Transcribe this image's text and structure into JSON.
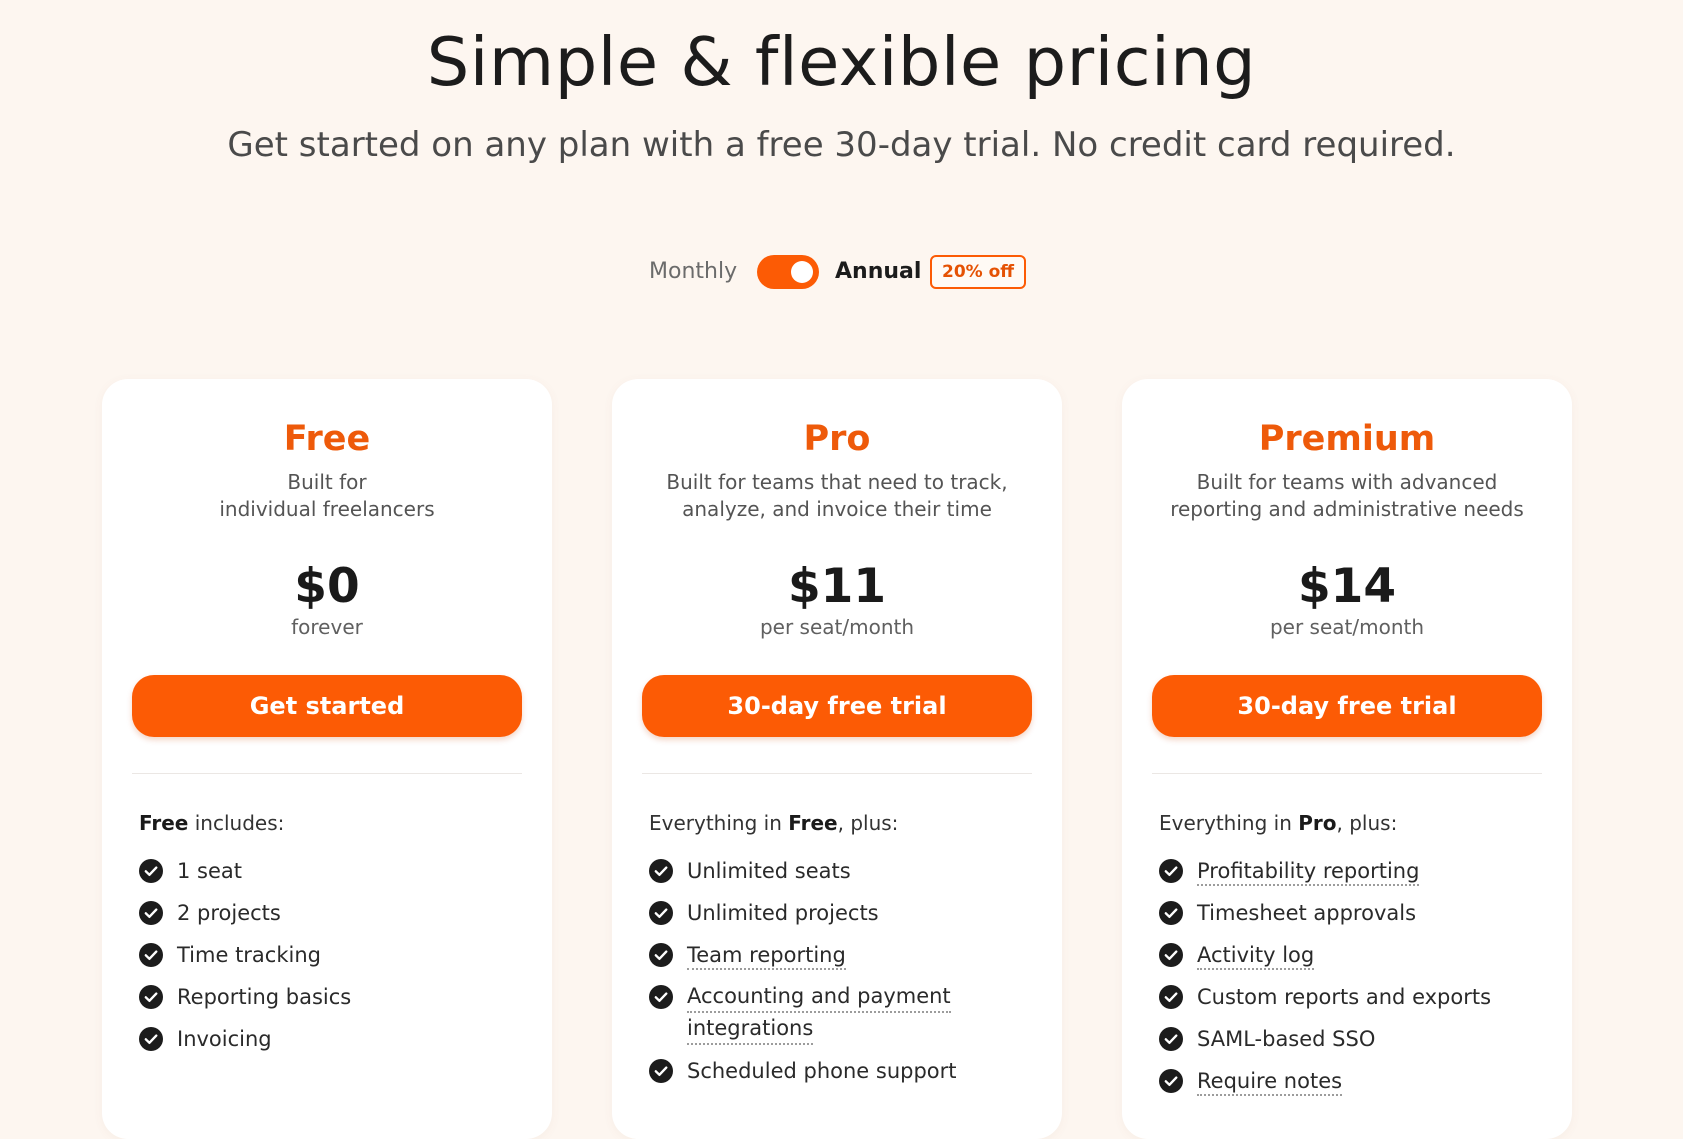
{
  "hero": {
    "title": "Simple & flexible pricing",
    "subtitle": "Get started on any plan with a free 30-day trial. No credit card required."
  },
  "billing": {
    "monthly_label": "Monthly",
    "annual_label": "Annual",
    "discount_badge": "20% off",
    "selected": "Annual"
  },
  "colors": {
    "accent": "#fc5b05",
    "plan_name": "#ee5a0a",
    "background": "#fdf6f0"
  },
  "plans": [
    {
      "name": "Free",
      "description_lines": [
        "Built for",
        "individual freelancers"
      ],
      "price": "$0",
      "period": "forever",
      "cta": "Get started",
      "includes_prefix": "",
      "includes_bold": "Free",
      "includes_suffix": " includes:",
      "features": [
        "1 seat",
        "2 projects",
        "Time tracking",
        "Reporting basics",
        "Invoicing"
      ]
    },
    {
      "name": "Pro",
      "description_lines": [
        "Built for teams that need to track,",
        "analyze, and invoice their time"
      ],
      "price": "$11",
      "period": "per seat/month",
      "cta": "30-day free trial",
      "includes_prefix": "Everything in ",
      "includes_bold": "Free",
      "includes_suffix": ", plus:",
      "features": [
        "Unlimited seats",
        "Unlimited projects",
        "Team reporting",
        "Accounting and payment",
        "integrations",
        "Scheduled phone support"
      ]
    },
    {
      "name": "Premium",
      "description_lines": [
        "Built for teams with advanced",
        "reporting and administrative needs"
      ],
      "price": "$14",
      "period": "per seat/month",
      "cta": "30-day free trial",
      "includes_prefix": "Everything in ",
      "includes_bold": "Pro",
      "includes_suffix": ", plus:",
      "features": [
        "Profitability reporting",
        "Timesheet approvals",
        "Activity log",
        "Custom reports and exports",
        "SAML-based SSO",
        "Require notes"
      ]
    }
  ],
  "icons": {
    "feature_check": "check-circle-icon"
  }
}
